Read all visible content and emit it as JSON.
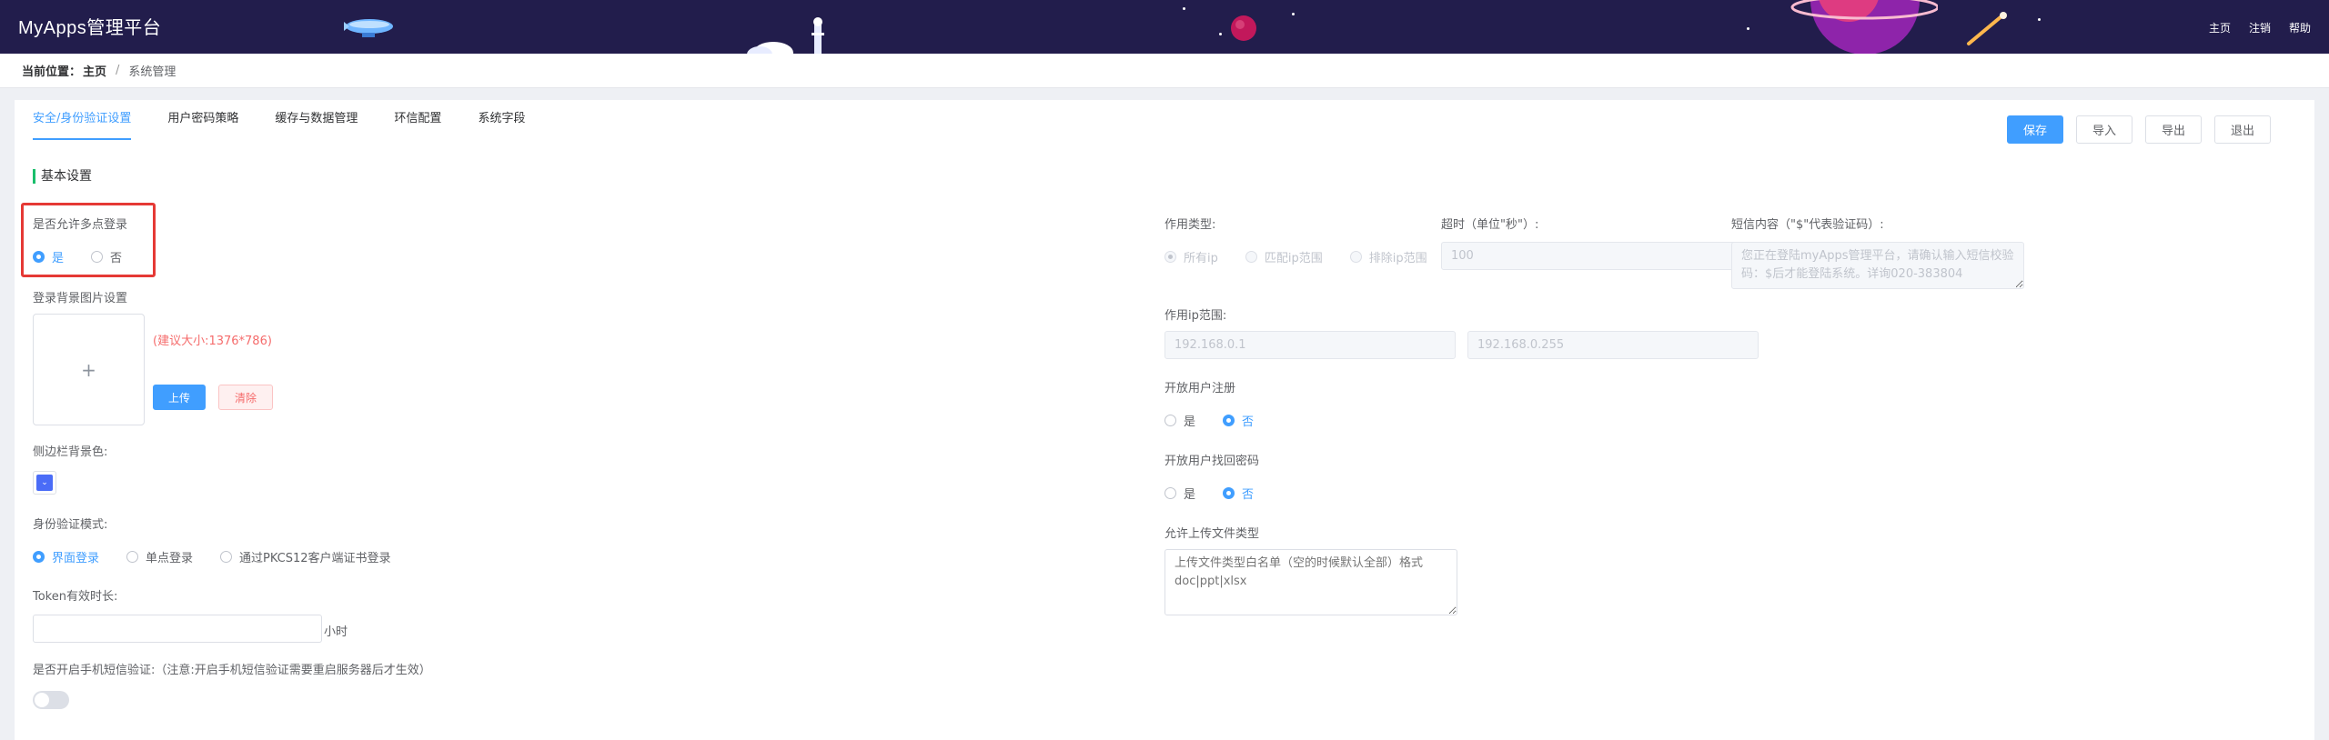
{
  "header": {
    "app_title": "MyApps管理平台",
    "links": [
      "主页",
      "注销",
      "帮助"
    ]
  },
  "breadcrumb": {
    "prefix": "当前位置：",
    "home": "主页",
    "separator": "/",
    "current": "系统管理"
  },
  "tabs": [
    {
      "label": "安全/身份验证设置",
      "active": true
    },
    {
      "label": "用户密码策略",
      "active": false
    },
    {
      "label": "缓存与数据管理",
      "active": false
    },
    {
      "label": "环信配置",
      "active": false
    },
    {
      "label": "系统字段",
      "active": false
    }
  ],
  "actions": {
    "save": "保存",
    "import": "导入",
    "export": "导出",
    "exit": "退出"
  },
  "section": {
    "title": "基本设置"
  },
  "multi_login": {
    "label": "是否允许多点登录",
    "options": [
      "是",
      "否"
    ],
    "selected": "是"
  },
  "login_bg": {
    "label": "登录背景图片设置",
    "plus": "+",
    "size_hint": "(建议大小:1376*786)",
    "upload_label": "上传",
    "clear_label": "清除"
  },
  "sidebar_color": {
    "label": "侧边栏背景色:",
    "value": "#4a6cf7",
    "chevron": "⌄"
  },
  "auth_mode": {
    "label": "身份验证模式:",
    "options": [
      "界面登录",
      "单点登录",
      "通过PKCS12客户端证书登录"
    ],
    "selected": "界面登录"
  },
  "token": {
    "label": "Token有效时长:",
    "value": "",
    "unit": "小时"
  },
  "sms_verify": {
    "label": "是否开启手机短信验证:（注意:开启手机短信验证需要重启服务器后才生效）",
    "enabled": false
  },
  "scope": {
    "type_label": "作用类型:",
    "options": [
      "所有ip",
      "匹配ip范围",
      "排除ip范围"
    ],
    "selected": "所有ip",
    "timeout_label": "超时（单位\"秒\"）:",
    "timeout_value": "100",
    "sms_content_label": "短信内容（\"$\"代表验证码）:",
    "sms_content_value": "您正在登陆myApps管理平台，请确认输入短信校验码：$后才能登陆系统。详询020-383804"
  },
  "ip_range": {
    "label": "作用ip范围:",
    "start": "192.168.0.1",
    "end": "192.168.0.255"
  },
  "open_register": {
    "label": "开放用户注册",
    "options": [
      "是",
      "否"
    ],
    "selected": "否"
  },
  "open_recover": {
    "label": "开放用户找回密码",
    "options": [
      "是",
      "否"
    ],
    "selected": "否"
  },
  "upload_types": {
    "label": "允许上传文件类型",
    "placeholder": "上传文件类型白名单（空的时候默认全部）格式doc|ppt|xlsx"
  },
  "colors": {
    "header_bg": "#221d4c",
    "accent": "#409eff",
    "highlight": "#e53935",
    "section_bar": "#19be6b"
  }
}
